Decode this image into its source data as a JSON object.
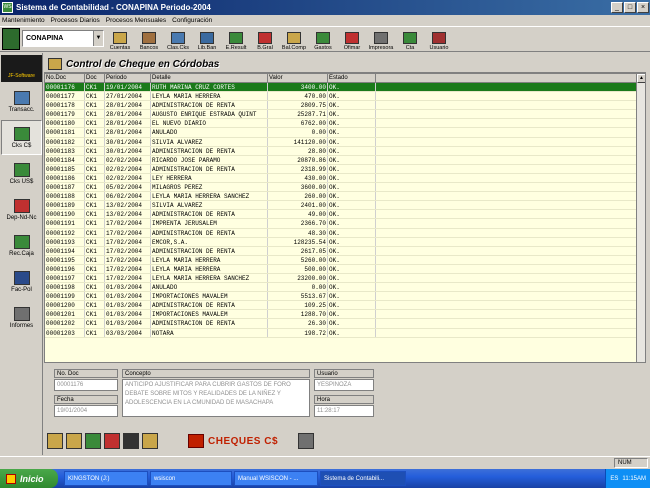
{
  "window": {
    "app_icon": "WS",
    "title": "Sistema de Contabilidad - CONAPINA Periodo-2004",
    "buttons": [
      "_",
      "□",
      "×"
    ]
  },
  "menu": [
    "Mantenimiento",
    "Procesos Diarios",
    "Procesos Mensuales",
    "Configuración"
  ],
  "toolbar": {
    "company": "CONAPINA",
    "buttons": [
      {
        "label": "Cuentas",
        "icon": "cuentas-icon",
        "color": "#c9a64a"
      },
      {
        "label": "Bancos",
        "icon": "bank-icon",
        "color": "#a07040"
      },
      {
        "label": "Clas.Cks",
        "icon": "checks-class-icon",
        "color": "#4a7ab0"
      },
      {
        "label": "Lib.Ban",
        "icon": "bank-book-icon",
        "color": "#3a6aa0"
      },
      {
        "label": "E.Result",
        "icon": "result-statement-icon",
        "color": "#3a8a3a"
      },
      {
        "label": "B.Gral",
        "icon": "balance-general-icon",
        "color": "#c03030"
      },
      {
        "label": "Bal.Comp",
        "icon": "balance-comp-icon",
        "color": "#c9a64a"
      },
      {
        "label": "Gastos",
        "icon": "expenses-icon",
        "color": "#3a8a3a"
      },
      {
        "label": "Ofimar",
        "icon": "ofimar-icon",
        "color": "#c03030"
      },
      {
        "label": "Impresora",
        "icon": "printer-icon",
        "color": "#707070"
      },
      {
        "label": "Cta",
        "icon": "account-icon",
        "color": "#3a8a3a"
      },
      {
        "label": "Usuario",
        "icon": "user-icon",
        "color": "#a03030"
      }
    ]
  },
  "sidebar": {
    "brand": "JF-Software",
    "items": [
      {
        "label": "Transacc.",
        "icon": "transactions-icon",
        "color": "#4a7ab0"
      },
      {
        "label": "Cks C$",
        "icon": "checks-cordoba-icon",
        "color": "#3a8a3a"
      },
      {
        "label": "Cks US$",
        "icon": "checks-dollar-icon",
        "color": "#3a8a3a"
      },
      {
        "label": "Dep-Nd-Nc",
        "icon": "deposits-icon",
        "color": "#c03030"
      },
      {
        "label": "Rec.Caja",
        "icon": "cash-receipt-icon",
        "color": "#3a8a3a"
      },
      {
        "label": "Fac-Pol",
        "icon": "invoice-icon",
        "color": "#2a4a8a"
      },
      {
        "label": "Informes",
        "icon": "reports-icon",
        "color": "#707070"
      }
    ]
  },
  "panel": {
    "title": "Control de Cheque en Córdobas",
    "columns": [
      "No.Doc",
      "Doc",
      "Periodo",
      "Detalle",
      "Valor",
      "Estado"
    ],
    "rows": [
      [
        "00001176",
        "CK1",
        "19/01/2004",
        "RUTH MARINA CRUZ CORTES",
        "3400.00",
        "OK."
      ],
      [
        "00001177",
        "CK1",
        "27/01/2004",
        "LEYLA MARIA HERRERA",
        "470.00",
        "OK."
      ],
      [
        "00001178",
        "CK1",
        "28/01/2004",
        "ADMINISTRACION DE RENTA",
        "2809.75",
        "OK."
      ],
      [
        "00001179",
        "CK1",
        "28/01/2004",
        "AUGUSTO ENRIQUE ESTRADA QUINT",
        "25287.71",
        "OK."
      ],
      [
        "00001180",
        "CK1",
        "28/01/2004",
        "EL NUEVO DIARIO",
        "6762.00",
        "OK."
      ],
      [
        "00001181",
        "CK1",
        "28/01/2004",
        "ANULADO",
        "0.00",
        "OK."
      ],
      [
        "00001182",
        "CK1",
        "30/01/2004",
        "SILVIA ALVAREZ",
        "141120.00",
        "OK."
      ],
      [
        "00001183",
        "CK1",
        "30/01/2004",
        "ADMINISTRACION DE RENTA",
        "28.80",
        "OK."
      ],
      [
        "00001184",
        "CK1",
        "02/02/2004",
        "RICARDO JOSE PARAMO",
        "20870.86",
        "OK."
      ],
      [
        "00001185",
        "CK1",
        "02/02/2004",
        "ADMINISTRACION DE RENTA",
        "2318.99",
        "OK."
      ],
      [
        "00001186",
        "CK1",
        "02/02/2004",
        "LEY HERRERA",
        "430.00",
        "OK."
      ],
      [
        "00001187",
        "CK1",
        "05/02/2004",
        "MILAGROS PEREZ",
        "3600.00",
        "OK."
      ],
      [
        "00001188",
        "CK1",
        "06/02/2004",
        "LEYLA MARIA HERRERA SANCHEZ",
        "260.00",
        "OK."
      ],
      [
        "00001189",
        "CK1",
        "13/02/2004",
        "SILVIA ALVAREZ",
        "2401.00",
        "OK."
      ],
      [
        "00001190",
        "CK1",
        "13/02/2004",
        "ADMINISTRACION DE RENTA",
        "49.00",
        "OK."
      ],
      [
        "00001191",
        "CK1",
        "17/02/2004",
        "IMPRENTA JERUSALEM",
        "2366.70",
        "OK."
      ],
      [
        "00001192",
        "CK1",
        "17/02/2004",
        "ADMINISTRACION DE RENTA",
        "48.30",
        "OK."
      ],
      [
        "00001193",
        "CK1",
        "17/02/2004",
        "EMCOR,S.A.",
        "128235.54",
        "OK."
      ],
      [
        "00001194",
        "CK1",
        "17/02/2004",
        "ADMINISTRACION DE RENTA",
        "2617.05",
        "OK."
      ],
      [
        "00001195",
        "CK1",
        "17/02/2004",
        "LEYLA MARIA HERRERA",
        "5260.00",
        "OK."
      ],
      [
        "00001196",
        "CK1",
        "17/02/2004",
        "LEYLA MARIA HERRERA",
        "500.00",
        "OK."
      ],
      [
        "00001197",
        "CK1",
        "17/02/2004",
        "LEYLA MARIA  HERRERA SANCHEZ",
        "23200.00",
        "OK."
      ],
      [
        "00001198",
        "CK1",
        "01/03/2004",
        "ANULADO",
        "0.00",
        "OK."
      ],
      [
        "00001199",
        "CK1",
        "01/03/2004",
        "IMPORTACIONES MAVALEM",
        "5513.67",
        "OK."
      ],
      [
        "00001200",
        "CK1",
        "01/03/2004",
        "ADMINISTRACION DE RENTA",
        "109.25",
        "OK."
      ],
      [
        "00001201",
        "CK1",
        "01/03/2004",
        "IMPORTACIONES MAVALEM",
        "1288.70",
        "OK."
      ],
      [
        "00001202",
        "CK1",
        "01/03/2004",
        "ADMINISTRACION DE RENTA",
        "26.30",
        "OK."
      ],
      [
        "00001203",
        "CK1",
        "03/03/2004",
        "NOTARA",
        "198.72",
        "OK."
      ]
    ],
    "selected_row": 0,
    "selected_color": "#1a7a1a",
    "grid_bg": "#ffffe0",
    "detail": {
      "no_doc_label": "No. Doc",
      "no_doc_value": "00001176",
      "concepto_label": "Concepto",
      "concepto_value": "ANTICIPO AJUSTIFICAR PARA CUBRIR GASTOS DE FORO DEBATE SOBRE MITOS Y REALIDADES DE LA NIÑEZ Y ADOLESCENCIA EN LA CMUNIDAD DE MASACHAPA",
      "usuario_label": "Usuario",
      "usuario_value": "YESPINOZA",
      "fecha_label": "Fecha",
      "fecha_value": "19/01/2004",
      "hora_label": "Hora",
      "hora_value": "11:28:17"
    }
  },
  "bottom": {
    "icons": [
      {
        "name": "new-doc-icon",
        "color": "#c9a64a"
      },
      {
        "name": "edit-icon",
        "color": "#c9a64a"
      },
      {
        "name": "list-icon",
        "color": "#3a8a3a"
      },
      {
        "name": "delete-icon",
        "color": "#c03030"
      },
      {
        "name": "search-icon",
        "color": "#333333"
      },
      {
        "name": "exit-door-icon",
        "color": "#c9a64a"
      }
    ],
    "brand": "CHEQUES C$",
    "brand_color": "#c02000"
  },
  "status": {
    "num": "NUM"
  },
  "taskbar": {
    "start": "Inicio",
    "tasks": [
      "KINGSTON (J:)",
      "wsiscon",
      "Manual WSISCON - ...",
      "Sistema de Contabili..."
    ],
    "active_task": 3,
    "tray_lang": "ES",
    "clock": "11:15AM"
  }
}
